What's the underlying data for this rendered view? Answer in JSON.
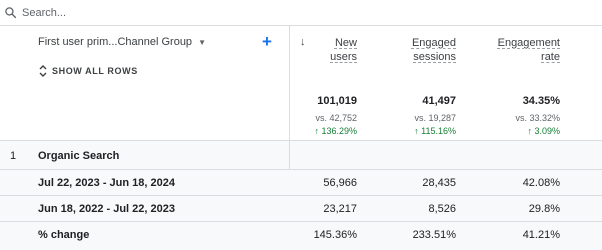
{
  "search": {
    "placeholder": "Search..."
  },
  "dimension": {
    "label": "First user prim...Channel Group",
    "show_all_label": "SHOW ALL ROWS"
  },
  "columns": [
    {
      "line1": "New",
      "line2": "users"
    },
    {
      "line1": "Engaged",
      "line2": "sessions"
    },
    {
      "line1": "Engagement",
      "line2": "rate"
    }
  ],
  "totals": [
    {
      "value": "101,019",
      "vs": "vs. 42,752",
      "change": "136.29%"
    },
    {
      "value": "41,497",
      "vs": "vs. 19,287",
      "change": "115.16%"
    },
    {
      "value": "34.35%",
      "vs": "vs. 33.32%",
      "change": "3.09%"
    }
  ],
  "group": {
    "index": "1",
    "label": "Organic Search"
  },
  "rows": [
    {
      "label": "Jul 22, 2023 - Jun 18, 2024",
      "values": [
        "56,966",
        "28,435",
        "42.08%"
      ]
    },
    {
      "label": "Jun 18, 2022 - Jul 22, 2023",
      "values": [
        "23,217",
        "8,526",
        "29.8%"
      ]
    },
    {
      "label": "% change",
      "values": [
        "145.36%",
        "233.51%",
        "41.21%"
      ]
    }
  ],
  "colors": {
    "accent": "#1a73e8",
    "positive": "#188038",
    "border": "#dadce0",
    "shade": "#f8f9fa"
  }
}
